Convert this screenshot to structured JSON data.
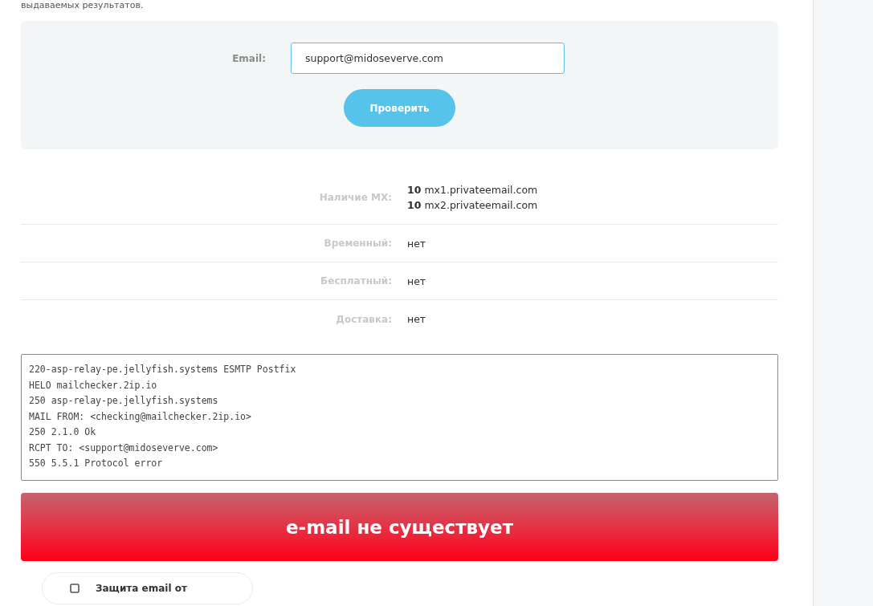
{
  "intro_text": "выдаваемых результатов.",
  "form": {
    "email_label": "Email:",
    "email_value": "support@midoseverve.com",
    "submit_button": "Проверить"
  },
  "results": [
    {
      "label": "Наличие MX:",
      "values": [
        "**10** mx1.privateemail.com",
        "**10** mx2.privateemail.com"
      ]
    },
    {
      "label": "Временный:",
      "values": [
        "нет"
      ]
    },
    {
      "label": "Бесплатный:",
      "values": [
        "нет"
      ]
    },
    {
      "label": "Доставка:",
      "values": [
        "нет"
      ]
    }
  ],
  "smtp_log": [
    "220-asp-relay-pe.jellyfish.systems ESMTP Postfix",
    "HELO mailchecker.2ip.io",
    "250 asp-relay-pe.jellyfish.systems",
    "MAIL FROM: <checking@mailchecker.2ip.io>",
    "250 2.1.0 Ok",
    "RCPT TO: <support@midoseverve.com>",
    "550 5.5.1 Protocol error"
  ],
  "result_banner": "e-mail не существует",
  "protection_card": {
    "label": "Защита email от"
  }
}
